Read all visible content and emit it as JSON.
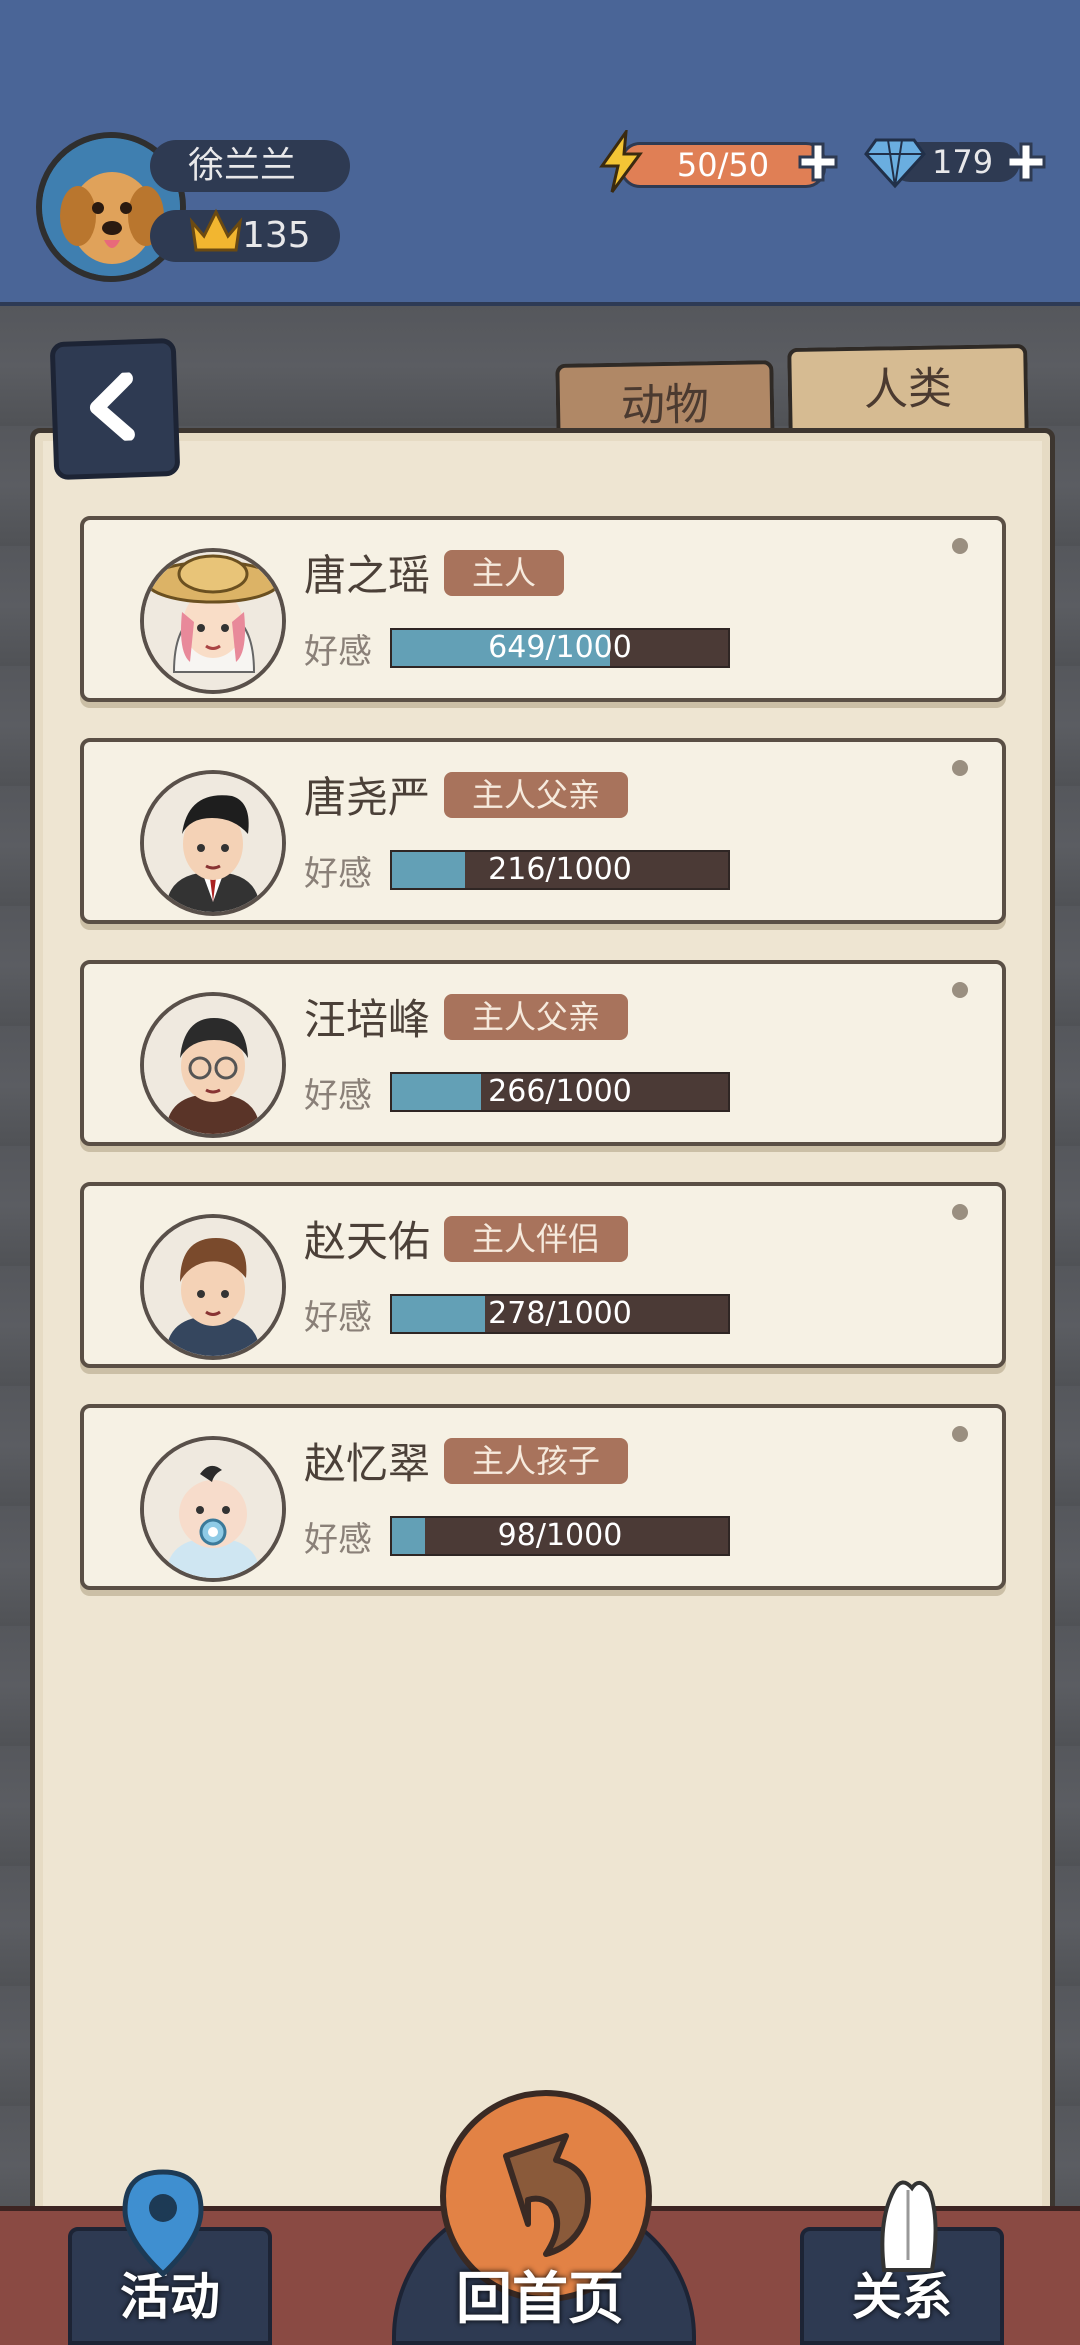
{
  "player": {
    "name": "徐兰兰",
    "crown_score": "135"
  },
  "resources": {
    "energy": "50/50",
    "gems": "179"
  },
  "tabs": [
    {
      "label": "动物",
      "selected": false
    },
    {
      "label": "人类",
      "selected": true
    }
  ],
  "favor_label": "好感",
  "people": [
    {
      "name": "唐之瑶",
      "relation": "主人",
      "favor_text": "649/1000",
      "favor": 0.649
    },
    {
      "name": "唐尧严",
      "relation": "主人父亲",
      "favor_text": "216/1000",
      "favor": 0.216
    },
    {
      "name": "汪培峰",
      "relation": "主人父亲",
      "favor_text": "266/1000",
      "favor": 0.266
    },
    {
      "name": "赵天佑",
      "relation": "主人伴侣",
      "favor_text": "278/1000",
      "favor": 0.278
    },
    {
      "name": "赵忆翠",
      "relation": "主人孩子",
      "favor_text": "98/1000",
      "favor": 0.098
    }
  ],
  "nav": {
    "activity": "活动",
    "home": "回首页",
    "relation": "关系"
  },
  "colors": {
    "topbar": "#4a6597",
    "paper": "#eee5d2",
    "tag": "#a8735c",
    "favor_fill": "#63a0b6"
  }
}
